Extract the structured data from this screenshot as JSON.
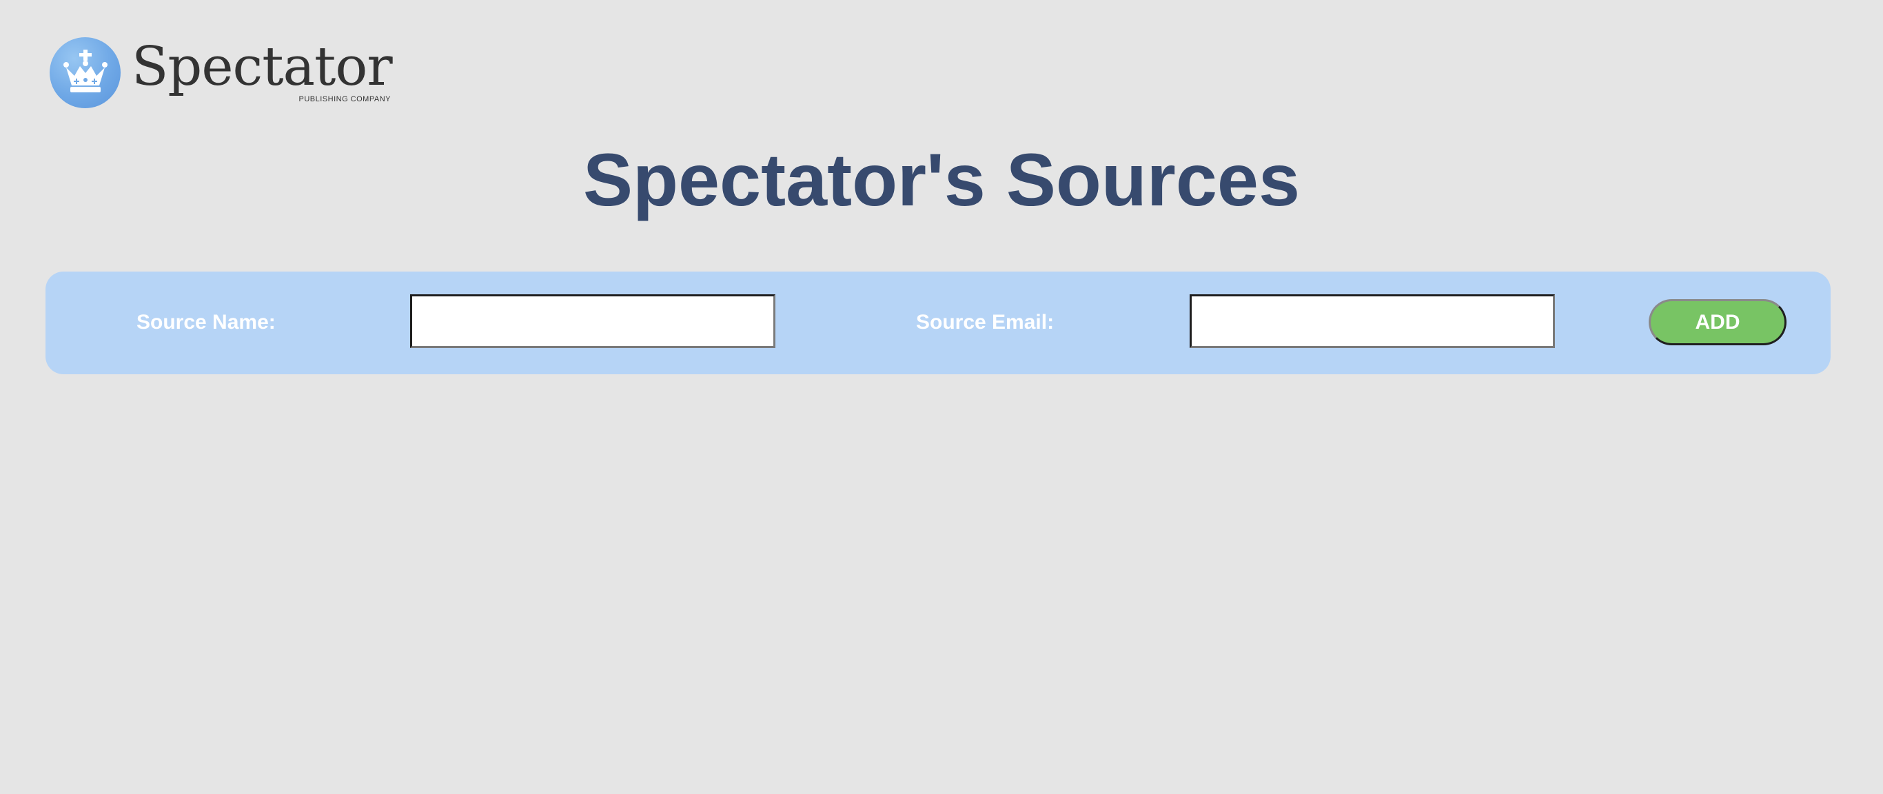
{
  "logo": {
    "wordmark": "Spectator",
    "tagline": "PUBLISHING COMPANY",
    "emblem_icon": "crown-icon",
    "circle_color": "#6fa8e6"
  },
  "page": {
    "title": "Spectator's Sources"
  },
  "form": {
    "source_name_label": "Source Name:",
    "source_name_value": "",
    "source_email_label": "Source Email:",
    "source_email_value": "",
    "add_label": "ADD"
  },
  "colors": {
    "background": "#e5e5e5",
    "title": "#374a6e",
    "form_bar": "#b6d4f6",
    "add_button": "#78c464",
    "label_text": "#ffffff"
  }
}
